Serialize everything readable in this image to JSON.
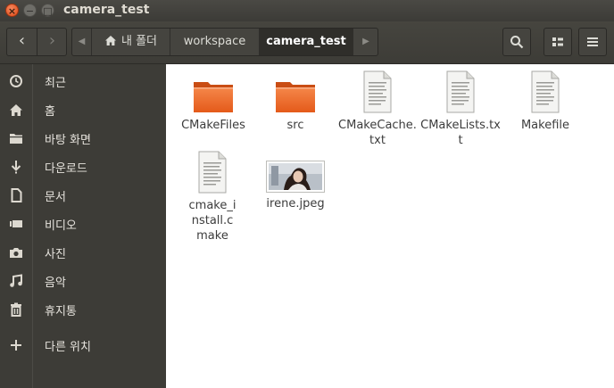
{
  "window": {
    "title": "camera_test"
  },
  "titlebar": {
    "close_glyph": "×",
    "min_glyph": "−",
    "max_glyph": "□"
  },
  "toolbar": {
    "back_glyph": "‹",
    "forward_glyph": "›",
    "path": [
      "내 폴더",
      "workspace",
      "camera_test"
    ],
    "scroll_left_glyph": "◀",
    "scroll_right_glyph": "▶"
  },
  "sidebar": {
    "items": [
      {
        "label": "최근",
        "icon": "clock-icon"
      },
      {
        "label": "홈",
        "icon": "home-icon"
      },
      {
        "label": "바탕 화면",
        "icon": "folder-icon"
      },
      {
        "label": "다운로드",
        "icon": "download-icon"
      },
      {
        "label": "문서",
        "icon": "document-icon"
      },
      {
        "label": "비디오",
        "icon": "video-icon"
      },
      {
        "label": "사진",
        "icon": "camera-icon"
      },
      {
        "label": "음악",
        "icon": "music-icon"
      },
      {
        "label": "휴지통",
        "icon": "trash-icon"
      },
      {
        "label": "다른 위치",
        "icon": "plus-icon"
      }
    ]
  },
  "files": [
    {
      "name": "CMakeFiles",
      "type": "folder"
    },
    {
      "name": "src",
      "type": "folder"
    },
    {
      "name": "CMakeCache.txt",
      "type": "text"
    },
    {
      "name": "CMakeLists.txt",
      "type": "text"
    },
    {
      "name": "Makefile",
      "type": "text"
    },
    {
      "name": "cmake_install.cmake",
      "type": "text"
    },
    {
      "name": "irene.jpeg",
      "type": "image"
    }
  ],
  "colors": {
    "folder_orange": "#e9611f",
    "sidebar_bg": "#3d3c37",
    "toolbar_bg": "#45443f",
    "close_button": "#df4a16"
  }
}
